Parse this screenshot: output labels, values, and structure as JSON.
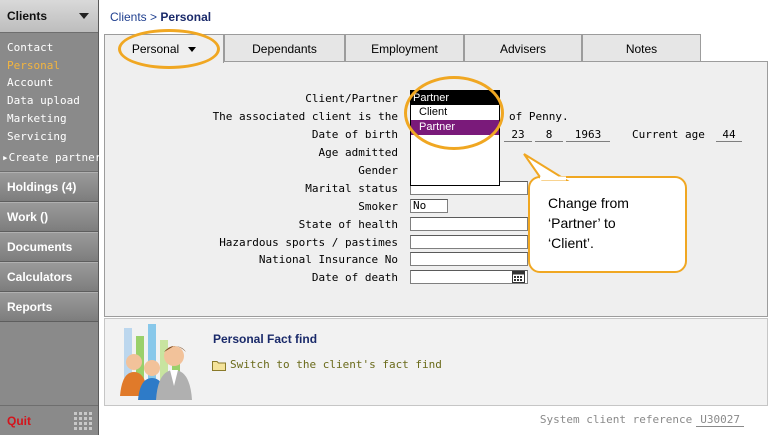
{
  "sidebar": {
    "header": "Clients",
    "sub_items": [
      "Contact",
      "Personal",
      "Account",
      "Data upload",
      "Marketing",
      "Servicing"
    ],
    "active_item": "Personal",
    "create_partner": "Create partner",
    "sections": [
      "Holdings (4)",
      "Work ()",
      "Documents",
      "Calculators",
      "Reports"
    ],
    "quit": "Quit"
  },
  "breadcrumb": {
    "parent": "Clients",
    "separator": ">",
    "current": "Personal"
  },
  "tabs": [
    "Personal",
    "Dependants",
    "Employment",
    "Advisers",
    "Notes"
  ],
  "form": {
    "client_partner_label": "Client/Partner",
    "associated_label": "The associated client is the",
    "associated_suffix": "of Penny.",
    "dob_label": "Date of birth",
    "dob_day": "23",
    "dob_month": "8",
    "dob_year": "1963",
    "current_age_label": "Current age",
    "current_age": "44",
    "age_admitted_label": "Age admitted",
    "gender_label": "Gender",
    "marital_label": "Marital status",
    "smoker_label": "Smoker",
    "smoker_value": "No",
    "health_label": "State of health",
    "hazard_label": "Hazardous sports / pastimes",
    "ni_label": "National Insurance No",
    "death_label": "Date of death"
  },
  "dropdown": {
    "selected": "Partner",
    "options": [
      "Client",
      "Partner"
    ],
    "highlighted": "Partner"
  },
  "fact_find": {
    "title": "Personal Fact find",
    "switch_link": "Switch to the client's fact find"
  },
  "system_ref": {
    "label": "System client reference",
    "value": "U30027"
  },
  "callout": {
    "lines": [
      "Change from",
      "‘Partner’ to",
      "‘Client’."
    ]
  },
  "colors": {
    "accent": "#f0a722",
    "sidebar": "#8a8a8a",
    "highlight": "#7a1a7a",
    "quit": "#d4141c",
    "link": "#1f3f8f"
  }
}
